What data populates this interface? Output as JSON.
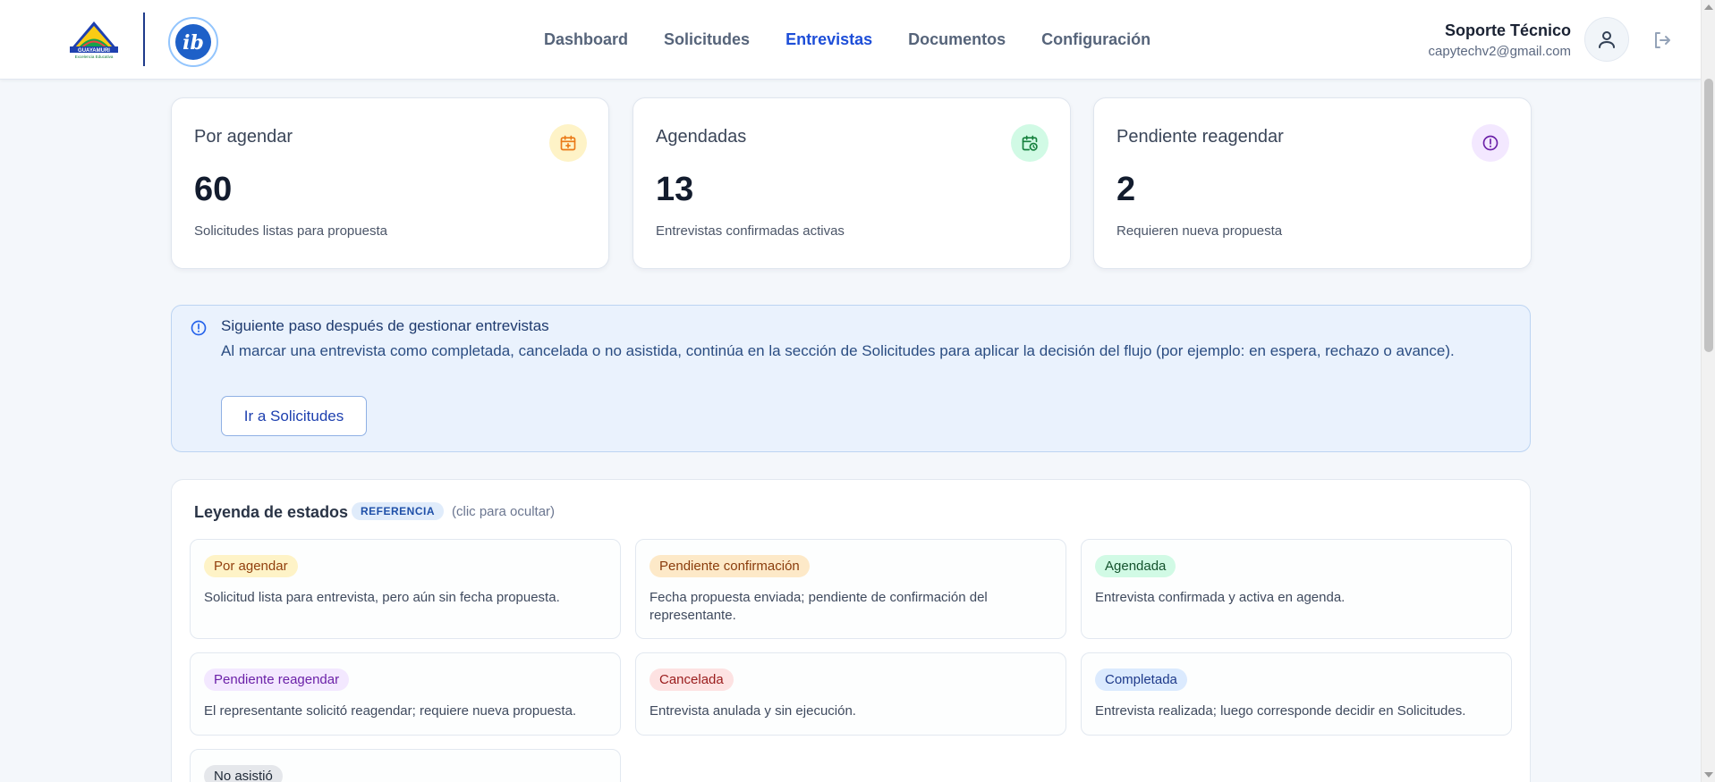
{
  "brand": {
    "logo_alt": "Colegio Guayamurí logo",
    "ib_logo_alt": "IB logo"
  },
  "nav": {
    "items": [
      {
        "label": "Dashboard",
        "active": false
      },
      {
        "label": "Solicitudes",
        "active": false
      },
      {
        "label": "Entrevistas",
        "active": true
      },
      {
        "label": "Documentos",
        "active": false
      },
      {
        "label": "Configuración",
        "active": false
      }
    ]
  },
  "user": {
    "name": "Soporte Técnico",
    "email": "capytechv2@gmail.com"
  },
  "stats": [
    {
      "title": "Por agendar",
      "value": "60",
      "subtitle": "Solicitudes listas para propuesta",
      "icon": "calendar-plus-icon",
      "icon_color": "#ea7a17",
      "icon_bg": "#fef3c7"
    },
    {
      "title": "Agendadas",
      "value": "13",
      "subtitle": "Entrevistas confirmadas activas",
      "icon": "calendar-clock-icon",
      "icon_color": "#15803d",
      "icon_bg": "#d1fae5"
    },
    {
      "title": "Pendiente reagendar",
      "value": "2",
      "subtitle": "Requieren nueva propuesta",
      "icon": "alert-circle-icon",
      "icon_color": "#7e22ce",
      "icon_bg": "#f3e8ff"
    }
  ],
  "info": {
    "title": "Siguiente paso después de gestionar entrevistas",
    "text": "Al marcar una entrevista como completada, cancelada o no asistida, continúa en la sección de Solicitudes para aplicar la decisión del flujo (por ejemplo: en espera, rechazo o avance).",
    "button": "Ir a Solicitudes"
  },
  "legend": {
    "title": "Leyenda de estados",
    "chip": "REFERENCIA",
    "hint": "(clic para ocultar)",
    "items": [
      {
        "label": "Por agendar",
        "desc": "Solicitud lista para entrevista, pero aún sin fecha propuesta.",
        "bg": "#fef3c7",
        "fg": "#92400e"
      },
      {
        "label": "Pendiente confirmación",
        "desc": "Fecha propuesta enviada; pendiente de confirmación del representante.",
        "bg": "#fde9c8",
        "fg": "#8a3c0c"
      },
      {
        "label": "Agendada",
        "desc": "Entrevista confirmada y activa en agenda.",
        "bg": "#d1fae5",
        "fg": "#14532d"
      },
      {
        "label": "Pendiente reagendar",
        "desc": "El representante solicitó reagendar; requiere nueva propuesta.",
        "bg": "#f3e8ff",
        "fg": "#6b21a8"
      },
      {
        "label": "Cancelada",
        "desc": "Entrevista anulada y sin ejecución.",
        "bg": "#fde2e2",
        "fg": "#991b1b"
      },
      {
        "label": "Completada",
        "desc": "Entrevista realizada; luego corresponde decidir en Solicitudes.",
        "bg": "#dbeafe",
        "fg": "#1e3a8a"
      },
      {
        "label": "No asistió",
        "desc": "",
        "bg": "#e5e7eb",
        "fg": "#1f2937"
      }
    ]
  }
}
